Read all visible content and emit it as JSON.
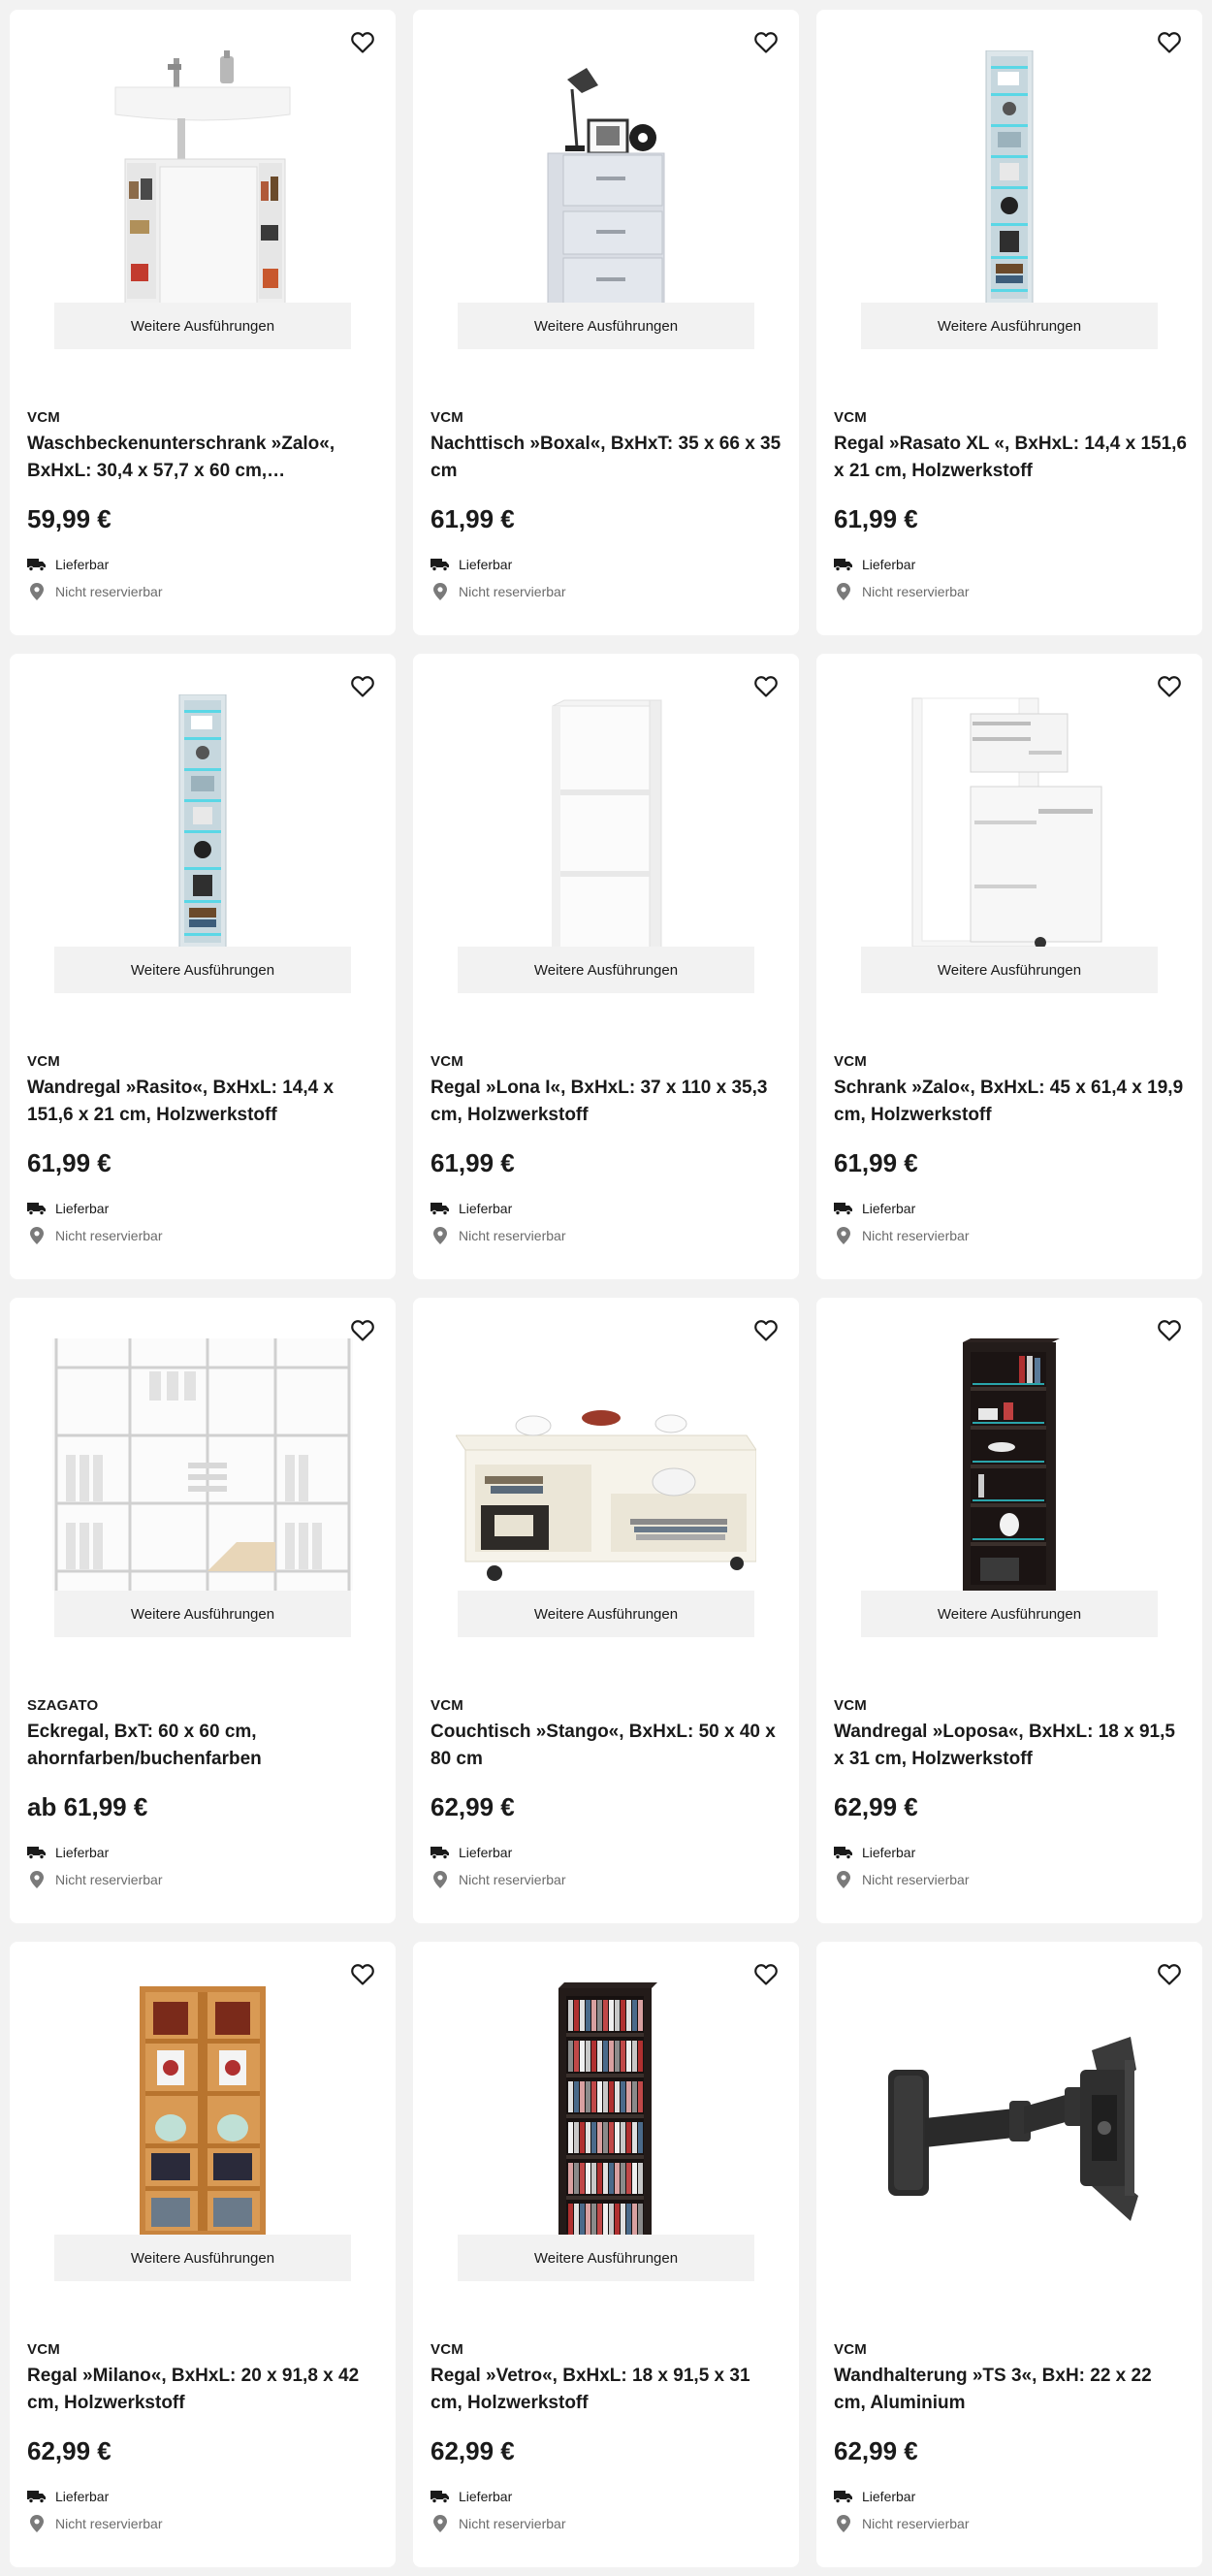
{
  "labels": {
    "variants": "Weitere Ausführungen",
    "delivery": "Lieferbar",
    "store": "Nicht reservierbar"
  },
  "products": [
    {
      "brand": "VCM",
      "title": "Waschbeckenunterschrank »Zalo«, BxHxL: 30,4 x 57,7 x 60 cm,…",
      "price": "59,99 €",
      "image": "sink-cabinet",
      "has_variants": true
    },
    {
      "brand": "VCM",
      "title": "Nachttisch »Boxal«, BxHxT: 35 x 66 x 35 cm",
      "price": "61,99 €",
      "image": "nightstand",
      "has_variants": true
    },
    {
      "brand": "VCM",
      "title": "Regal »Rasato XL «, BxHxL: 14,4 x 151,6 x 21 cm, Holzwerkstoff",
      "price": "61,99 €",
      "image": "narrow-shelf-led",
      "has_variants": true
    },
    {
      "brand": "VCM",
      "title": "Wandregal »Rasito«, BxHxL: 14,4 x 151,6 x 21 cm, Holzwerkstoff",
      "price": "61,99 €",
      "image": "narrow-shelf-led",
      "has_variants": true
    },
    {
      "brand": "VCM",
      "title": "Regal »Lona I«, BxHxL: 37 x 110 x 35,3 cm, Holzwerkstoff",
      "price": "61,99 €",
      "image": "white-shelf",
      "has_variants": true
    },
    {
      "brand": "VCM",
      "title": "Schrank »Zalo«, BxHxL: 45 x 61,4 x 19,9 cm, Holzwerkstoff",
      "price": "61,99 €",
      "image": "drawer-cabinet",
      "has_variants": true
    },
    {
      "brand": "SZAGATO",
      "title": "Eckregal, BxT: 60 x 60 cm, ahornfarben/buchenfarben",
      "price": "ab 61,99 €",
      "image": "corner-shelf",
      "has_variants": true
    },
    {
      "brand": "VCM",
      "title": "Couchtisch »Stango«, BxHxL: 50 x 40 x 80 cm",
      "price": "62,99 €",
      "image": "coffee-table",
      "has_variants": true
    },
    {
      "brand": "VCM",
      "title": "Wandregal »Loposa«, BxHxL: 18 x 91,5 x 31 cm, Holzwerkstoff",
      "price": "62,99 €",
      "image": "black-shelf",
      "has_variants": true
    },
    {
      "brand": "VCM",
      "title": "Regal »Milano«, BxHxL: 20 x 91,8 x 42 cm, Holzwerkstoff",
      "price": "62,99 €",
      "image": "beech-shelf",
      "has_variants": true
    },
    {
      "brand": "VCM",
      "title": "Regal »Vetro«, BxHxL: 18 x 91,5 x 31 cm, Holzwerkstoff",
      "price": "62,99 €",
      "image": "cd-tower",
      "has_variants": true
    },
    {
      "brand": "VCM",
      "title": "Wandhalterung »TS 3«, BxH: 22 x 22 cm, Aluminium",
      "price": "62,99 €",
      "image": "tv-wall-mount",
      "has_variants": false
    }
  ]
}
